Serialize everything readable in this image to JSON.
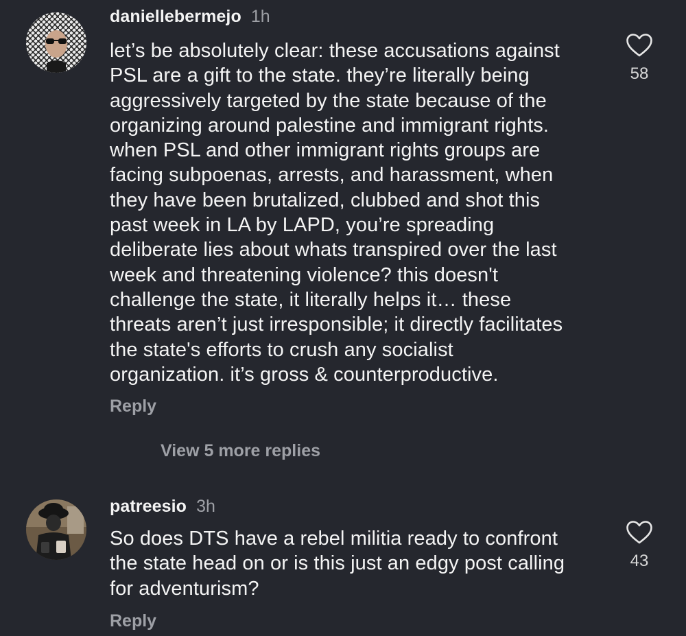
{
  "comments": [
    {
      "username": "daniellebermejo",
      "time": "1h",
      "lines": [
        "let’s be absolutely clear: these accusations against",
        "PSL are a gift to the state. they’re literally being",
        "aggressively targeted by the state because of the",
        "organizing around palestine and immigrant rights.",
        "when PSL and other immigrant rights groups are",
        "facing subpoenas, arrests, and harassment, when",
        "they have been brutalized, clubbed and shot this",
        "past week in LA by LAPD, you’re spreading",
        "deliberate lies about whats transpired over the last",
        "week and threatening violence? this doesn't",
        "challenge the state, it literally helps it… these",
        "threats aren’t just irresponsible; it directly facilitates",
        "the state's efforts to crush any socialist",
        "organization. it’s gross & counterproductive."
      ],
      "likes": "58",
      "reply_label": "Reply",
      "view_replies_label": "View 5 more replies",
      "heart_icon": "heart-outline-icon"
    },
    {
      "username": "patreesio",
      "time": "3h",
      "lines": [
        "So does DTS have a rebel militia ready to confront",
        "the state head on or is this just an edgy post calling",
        "for adventurism?"
      ],
      "likes": "43",
      "reply_label": "Reply",
      "heart_icon": "heart-outline-icon"
    }
  ],
  "colors": {
    "background": "#25272e",
    "primary_text": "#f4f4f4",
    "secondary_text": "#9ea0a6"
  }
}
